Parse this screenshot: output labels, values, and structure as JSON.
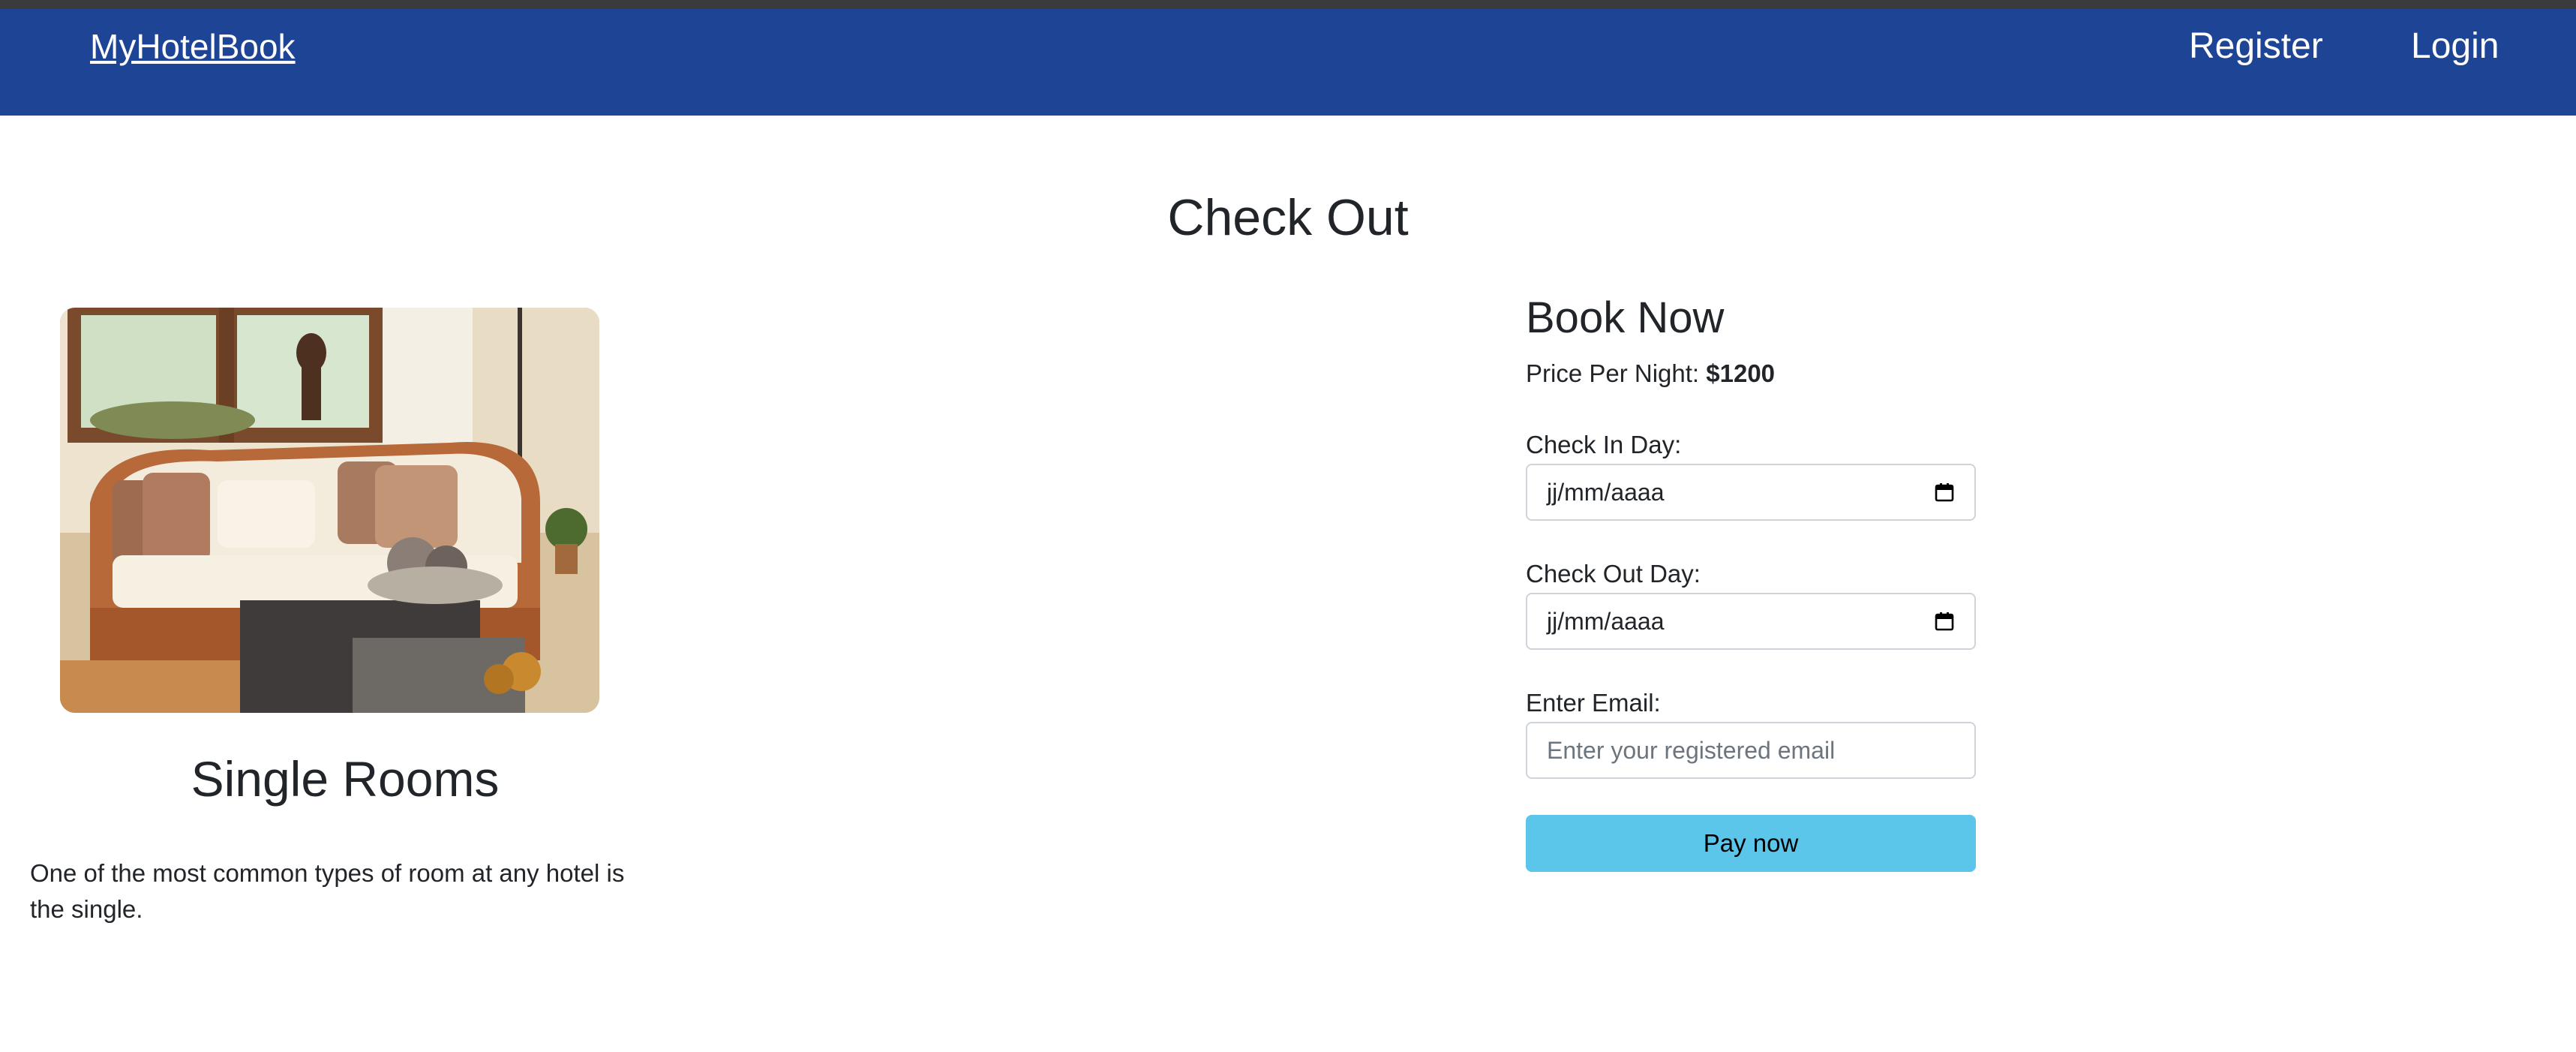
{
  "navbar": {
    "brand": "MyHotelBook",
    "links": [
      "Register",
      "Login"
    ]
  },
  "page": {
    "title": "Check Out"
  },
  "room": {
    "image_alt": "Living room with wicker sofa",
    "title": "Single Rooms",
    "description": "One of the most common types of room at any hotel is the single."
  },
  "booking": {
    "title": "Book Now",
    "price_label": "Price Per Night:",
    "price_value": "$1200",
    "check_in_label": "Check In Day:",
    "check_in_value": "jj/mm/aaaa",
    "check_out_label": "Check Out Day:",
    "check_out_value": "jj/mm/aaaa",
    "email_label": "Enter Email:",
    "email_placeholder": "Enter your registered email",
    "pay_button": "Pay now"
  },
  "icons": {
    "calendar": "calendar-icon"
  },
  "colors": {
    "navbar": "#1e4496",
    "pay_button": "#5bc5ea",
    "text": "#212529"
  }
}
